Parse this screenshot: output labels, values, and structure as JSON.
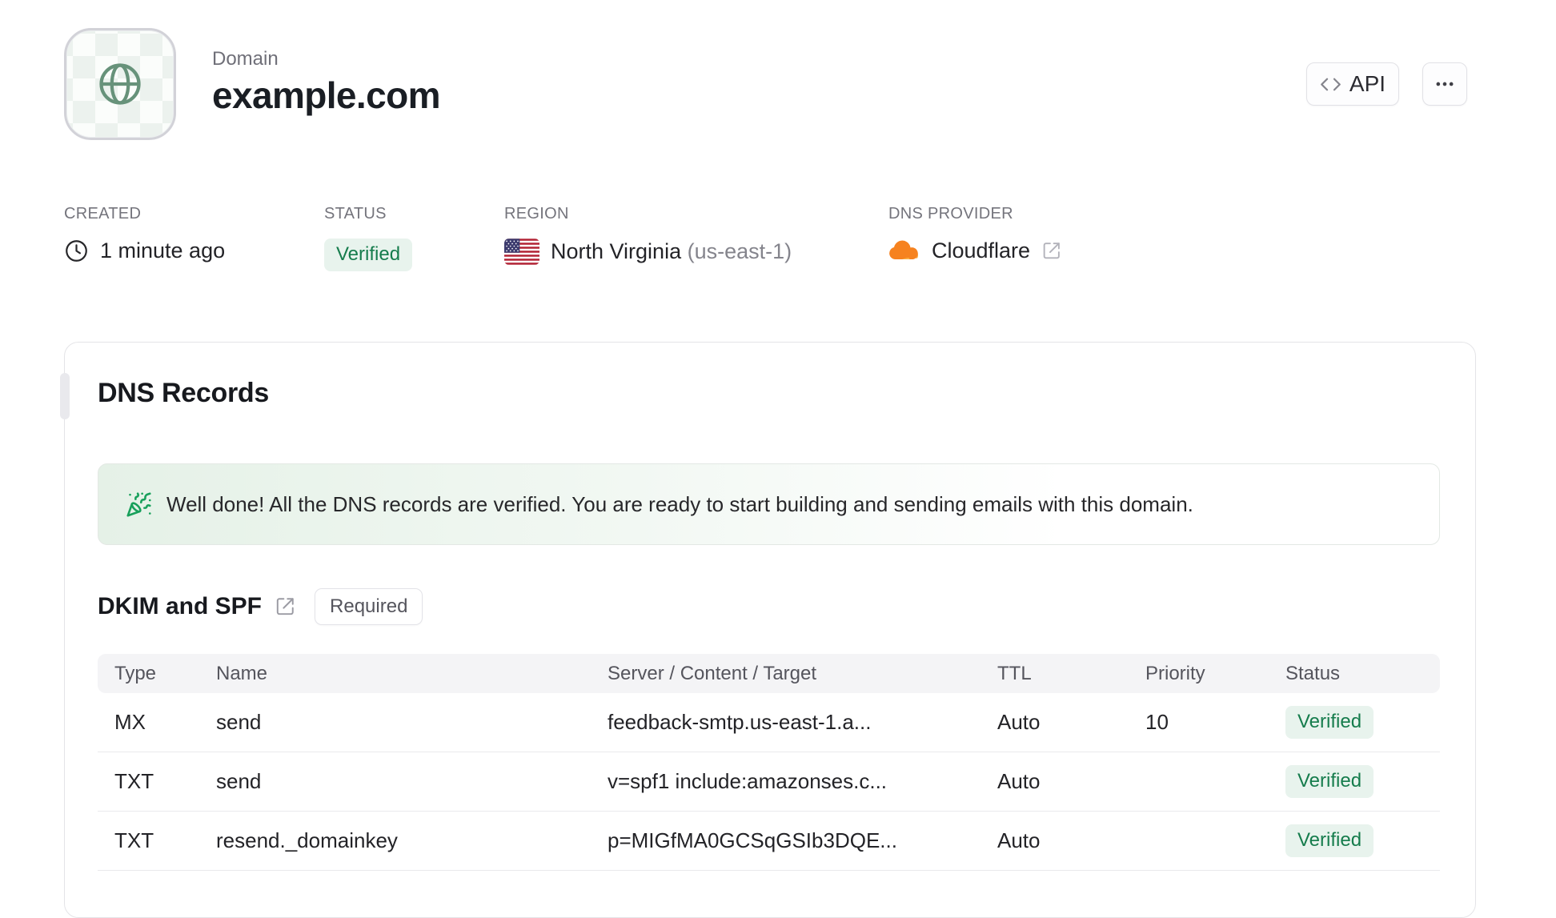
{
  "header": {
    "kicker": "Domain",
    "title": "example.com",
    "api_button_label": "API"
  },
  "meta": {
    "created": {
      "label": "CREATED",
      "value": "1 minute ago"
    },
    "status": {
      "label": "STATUS",
      "value": "Verified"
    },
    "region": {
      "label": "REGION",
      "value": "North Virginia",
      "code": "(us-east-1)"
    },
    "dns_provider": {
      "label": "DNS PROVIDER",
      "value": "Cloudflare"
    }
  },
  "dns_card": {
    "title": "DNS Records",
    "banner_message": "Well done! All the DNS records are verified. You are ready to start building and sending emails with this domain.",
    "section": {
      "title": "DKIM and SPF",
      "badge": "Required"
    },
    "table": {
      "headers": [
        "Type",
        "Name",
        "Server / Content / Target",
        "TTL",
        "Priority",
        "Status"
      ],
      "rows": [
        {
          "type": "MX",
          "name": "send",
          "content": "feedback-smtp.us-east-1.a...",
          "ttl": "Auto",
          "priority": "10",
          "status": "Verified"
        },
        {
          "type": "TXT",
          "name": "send",
          "content": "v=spf1 include:amazonses.c...",
          "ttl": "Auto",
          "priority": "",
          "status": "Verified"
        },
        {
          "type": "TXT",
          "name": "resend._domainkey",
          "content": "p=MIGfMA0GCSqGSIb3DQE...",
          "ttl": "Auto",
          "priority": "",
          "status": "Verified"
        }
      ]
    }
  },
  "colors": {
    "accent_green": "#157c4c",
    "badge_green_bg": "#e8f3ed",
    "banner_green": "#e5f1e7",
    "globe_green": "#67927a",
    "party_icon_green": "#18a05b",
    "cloudflare_orange": "#f6821f",
    "cloudflare_orange_light": "#fbad41",
    "border": "#e4e4e7",
    "table_header_bg": "#f4f4f6",
    "text_dark": "#1a1e24",
    "text_gray": "#74747c"
  }
}
